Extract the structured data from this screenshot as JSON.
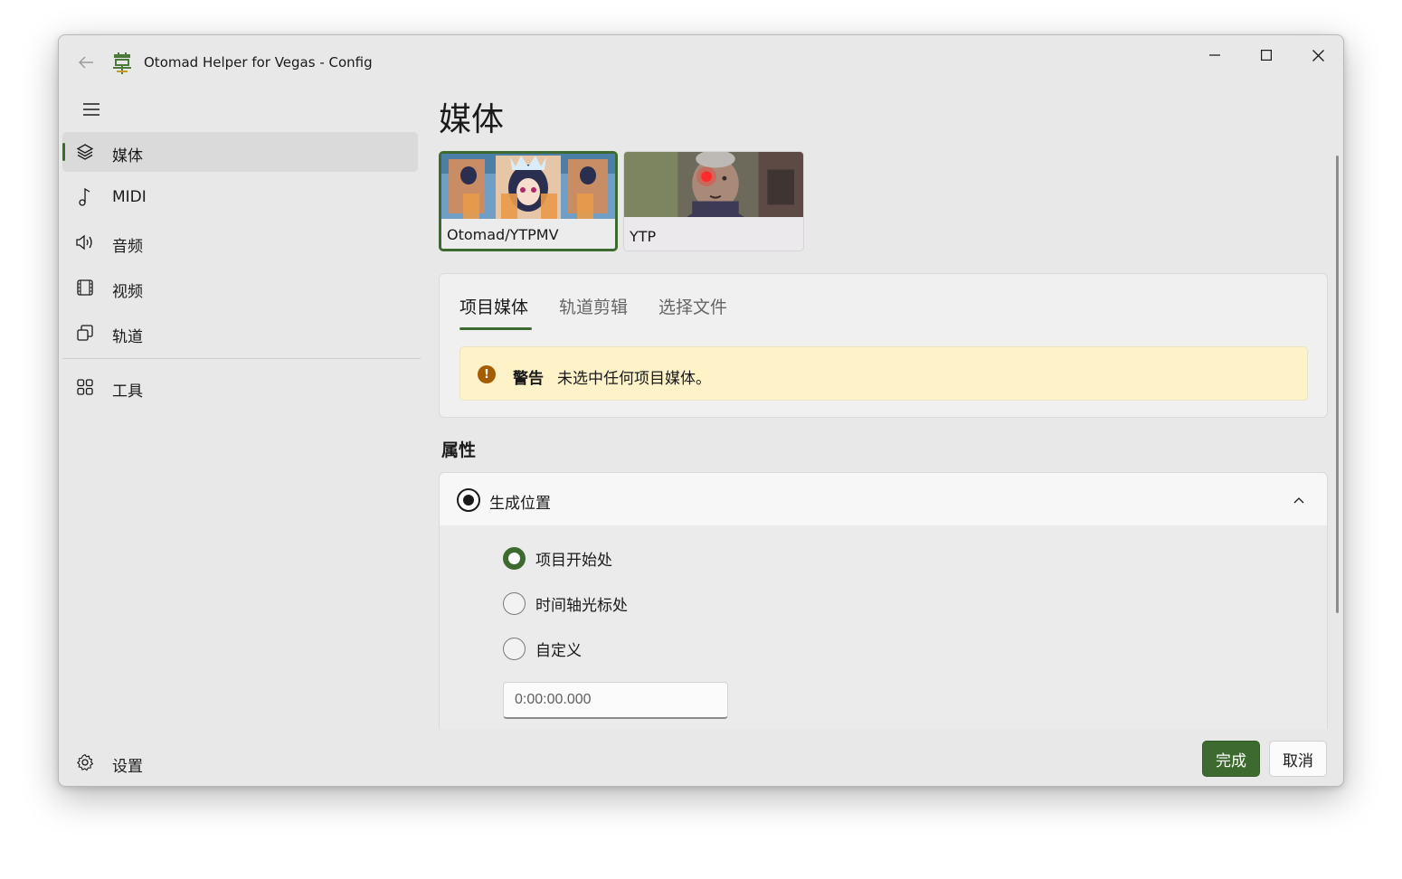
{
  "window": {
    "title": "Otomad Helper for Vegas - Config"
  },
  "sidebar": {
    "items": [
      {
        "label": "媒体",
        "icon": "layers-icon"
      },
      {
        "label": "MIDI",
        "icon": "music-note-icon"
      },
      {
        "label": "音频",
        "icon": "speaker-icon"
      },
      {
        "label": "视频",
        "icon": "film-icon"
      },
      {
        "label": "轨道",
        "icon": "track-copy-icon"
      },
      {
        "label": "工具",
        "icon": "grid-apps-icon"
      }
    ],
    "settings_label": "设置"
  },
  "main": {
    "title": "媒体",
    "presets": [
      {
        "label": "Otomad/YTPMV",
        "selected": true
      },
      {
        "label": "YTP",
        "selected": false
      }
    ],
    "tabs": [
      {
        "label": "项目媒体"
      },
      {
        "label": "轨道剪辑"
      },
      {
        "label": "选择文件"
      }
    ],
    "warning": {
      "title": "警告",
      "message": "未选中任何项目媒体。"
    },
    "section_title": "属性",
    "position": {
      "label": "生成位置",
      "options": [
        {
          "label": "项目开始处",
          "checked": true
        },
        {
          "label": "时间轴光标处",
          "checked": false
        },
        {
          "label": "自定义",
          "checked": false
        }
      ],
      "custom_time": "0:00:00.000"
    }
  },
  "footer": {
    "ok_label": "完成",
    "cancel_label": "取消"
  },
  "colors": {
    "accent": "#3d6b2f",
    "warning_bg": "#fdf2c8"
  }
}
